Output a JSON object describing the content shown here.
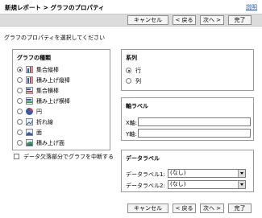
{
  "header": {
    "title": "新規レポート > グラフのプロパティ",
    "help_label": "説明"
  },
  "buttons": {
    "cancel": "キャンセル",
    "back": "< 戻る",
    "next": "次へ >",
    "finish": "完了"
  },
  "prompt": "グラフのプロパティを選択してください",
  "chart_type": {
    "title": "グラフの種類",
    "options": [
      {
        "label": "集合縦棒",
        "icon": "clustered-column-icon",
        "selected": true
      },
      {
        "label": "積み上げ縦棒",
        "icon": "stacked-column-icon",
        "selected": false
      },
      {
        "label": "集合横棒",
        "icon": "clustered-bar-icon",
        "selected": false
      },
      {
        "label": "積み上げ横棒",
        "icon": "stacked-bar-icon",
        "selected": false
      },
      {
        "label": "円",
        "icon": "pie-chart-icon",
        "selected": false
      },
      {
        "label": "折れ線",
        "icon": "line-chart-icon",
        "selected": false
      },
      {
        "label": "面",
        "icon": "area-chart-icon",
        "selected": false
      },
      {
        "label": "積み上げ面",
        "icon": "stacked-area-icon",
        "selected": false
      }
    ]
  },
  "center_checkbox": {
    "label": "データ欠落部分でグラフを中断する",
    "checked": false
  },
  "series": {
    "title": "系列",
    "options": [
      {
        "label": "行",
        "selected": true
      },
      {
        "label": "列",
        "selected": false
      }
    ]
  },
  "axis_labels": {
    "title": "軸ラベル",
    "x_label": "X軸:",
    "y_label": "Y軸:",
    "x_value": "",
    "y_value": ""
  },
  "data_labels": {
    "title": "データラベル",
    "label1": "データラベル1:",
    "label2": "データラベル2:",
    "value1": "(なし)",
    "value2": "(なし)"
  }
}
